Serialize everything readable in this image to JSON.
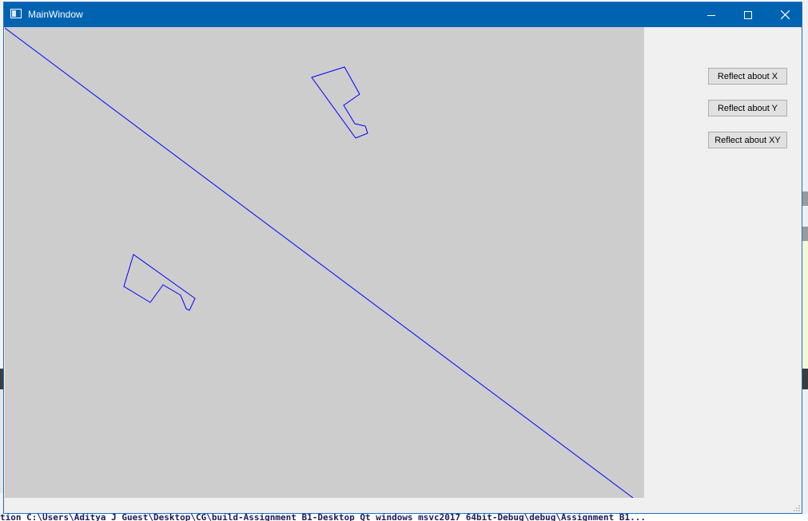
{
  "window": {
    "title": "MainWindow",
    "controls": {
      "minimize_icon": "minimize-icon",
      "maximize_icon": "maximize-icon",
      "close_icon": "close-icon"
    },
    "titlebar_color": "#0063b1"
  },
  "canvas": {
    "background": "#cdcdcd",
    "stroke_color": "#0000ff"
  },
  "buttons": {
    "reflect_x": "Reflect about X",
    "reflect_y": "Reflect about Y",
    "reflect_xy": "Reflect about XY"
  },
  "background_terminal_text": "tion C:\\Users\\Aditya J Guest\\Desktop\\CG\\build-Assignment_B1-Desktop_Qt_windows_msvc2017_64bit-Debug\\debug\\Assignment_B1..."
}
